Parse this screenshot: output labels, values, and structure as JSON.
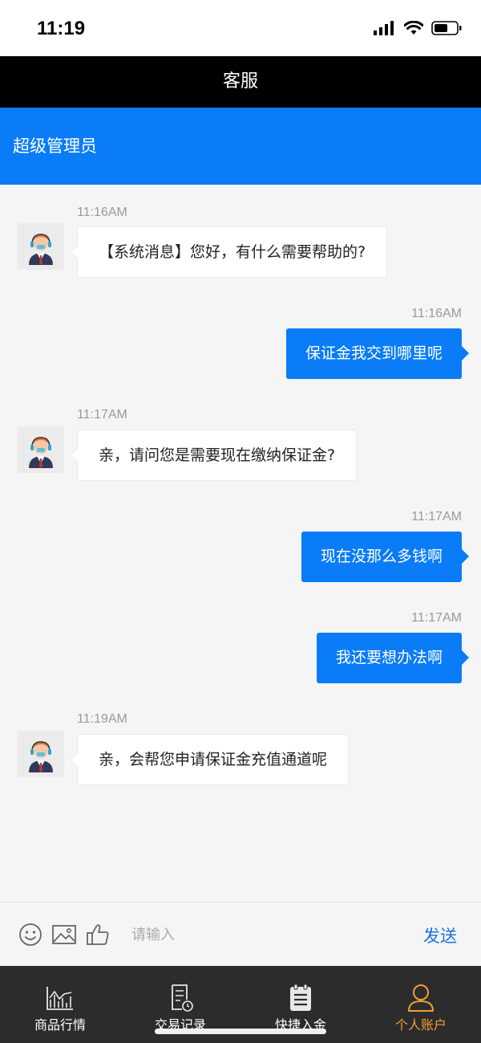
{
  "status_bar": {
    "time": "11:19"
  },
  "header": {
    "title": "客服"
  },
  "agent": {
    "name": "超级管理员"
  },
  "messages": [
    {
      "side": "in",
      "time": "11:16AM",
      "text": "【系统消息】您好，有什么需要帮助的?"
    },
    {
      "side": "out",
      "time": "11:16AM",
      "text": "保证金我交到哪里呢"
    },
    {
      "side": "in",
      "time": "11:17AM",
      "text": "亲，请问您是需要现在缴纳保证金?"
    },
    {
      "side": "out",
      "time": "11:17AM",
      "text": "现在没那么多钱啊"
    },
    {
      "side": "out",
      "time": "11:17AM",
      "text": "我还要想办法啊"
    },
    {
      "side": "in",
      "time": "11:19AM",
      "text": "亲，会帮您申请保证金充值通道呢"
    }
  ],
  "input": {
    "placeholder": "请输入",
    "value": "",
    "send_label": "发送"
  },
  "tabs": [
    {
      "label": "商品行情",
      "icon": "chart-icon",
      "active": false
    },
    {
      "label": "交易记录",
      "icon": "document-clock-icon",
      "active": false
    },
    {
      "label": "快捷入金",
      "icon": "clipboard-icon",
      "active": false
    },
    {
      "label": "个人账户",
      "icon": "person-icon",
      "active": true
    }
  ],
  "colors": {
    "accent": "#0a7cf7",
    "active_tab": "#f0a030",
    "title_bar": "#000000",
    "tab_bar": "#2c2c2c"
  }
}
